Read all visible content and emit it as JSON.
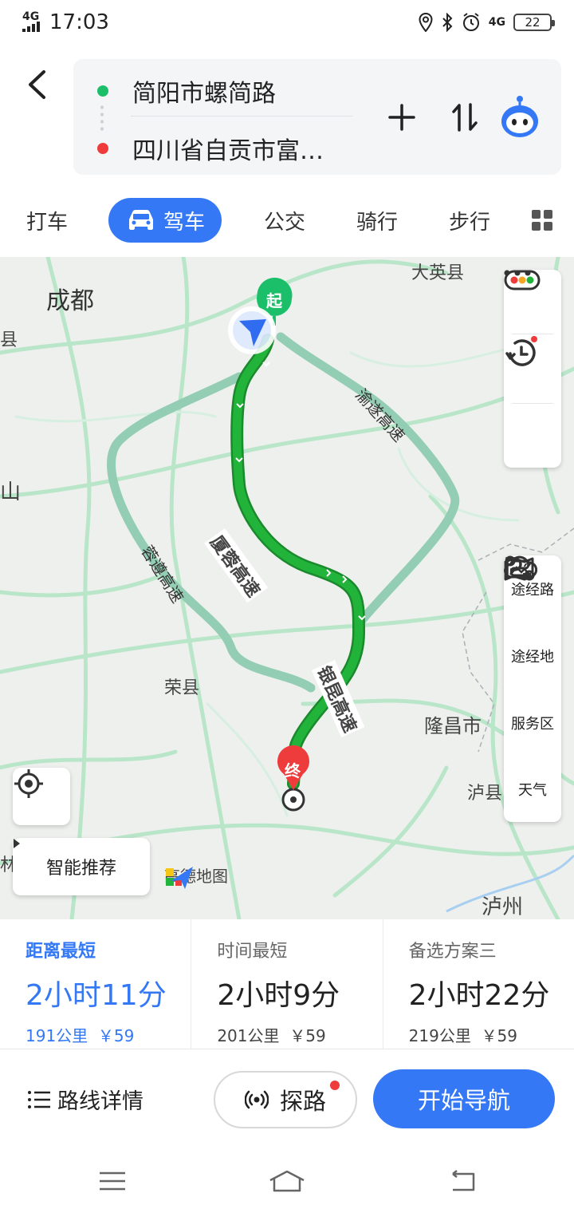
{
  "status_bar": {
    "network": "4G",
    "time": "17:03",
    "network_right": "4G",
    "battery": "22",
    "icons": [
      "location-icon",
      "bluetooth-icon",
      "alarm-icon",
      "signal-icon",
      "battery-icon"
    ]
  },
  "header": {
    "back_icon": "chevron-left-icon",
    "start": "简阳市螺简路",
    "end": "四川省自贡市富…",
    "add_icon": "plus-icon",
    "swap_icon": "swap-icon",
    "assistant_icon": "assistant-avatar-icon",
    "start_color": "#1bbf6a",
    "end_color": "#ee3b3b"
  },
  "tabs": [
    {
      "label": "打车"
    },
    {
      "label": "驾车",
      "active": true
    },
    {
      "label": "公交"
    },
    {
      "label": "骑行"
    },
    {
      "label": "步行"
    }
  ],
  "map": {
    "labels": {
      "chengdu": "成都",
      "dayingxian": "大英县",
      "xian_left": "县",
      "shan_left": "山",
      "rongxian": "荣县",
      "longchang": "隆昌市",
      "luxian": "泸县",
      "luzhou": "泸州",
      "lin_left": "林"
    },
    "roads": {
      "xiarong": "厦蓉高速",
      "yinkun": "银昆高速",
      "yusui": "渝遂高速",
      "rongzun": "蓉遵高速"
    },
    "markers": {
      "start": "起",
      "end": "终"
    },
    "side_tools": {
      "traffic_icon": "traffic-light-icon",
      "history_icon": "history-icon",
      "more_icon": "more-icon"
    },
    "side_panel": [
      {
        "label": "途经路",
        "icon": "route-waypoint-icon"
      },
      {
        "label": "途经地",
        "icon": "map-pin-icon"
      },
      {
        "label": "服务区",
        "icon": "parking-service-icon"
      },
      {
        "label": "天气",
        "icon": "cloud-icon"
      }
    ],
    "smart_recommend": "智能推荐",
    "logo": "高德地图",
    "route_color": "#22b43a",
    "alt_route_color": "#93cdb3"
  },
  "routes": [
    {
      "title": "距离最短",
      "time": "2小时11分",
      "distance": "191公里",
      "toll": "￥59",
      "selected": true
    },
    {
      "title": "时间最短",
      "time": "2小时9分",
      "distance": "201公里",
      "toll": "￥59"
    },
    {
      "title": "备选方案三",
      "time": "2小时22分",
      "distance": "219公里",
      "toll": "￥59"
    }
  ],
  "actions": {
    "details": "路线详情",
    "explore": "探路",
    "start_nav": "开始导航"
  },
  "colors": {
    "accent": "#3478f6",
    "alert": "#ee3b3b"
  }
}
